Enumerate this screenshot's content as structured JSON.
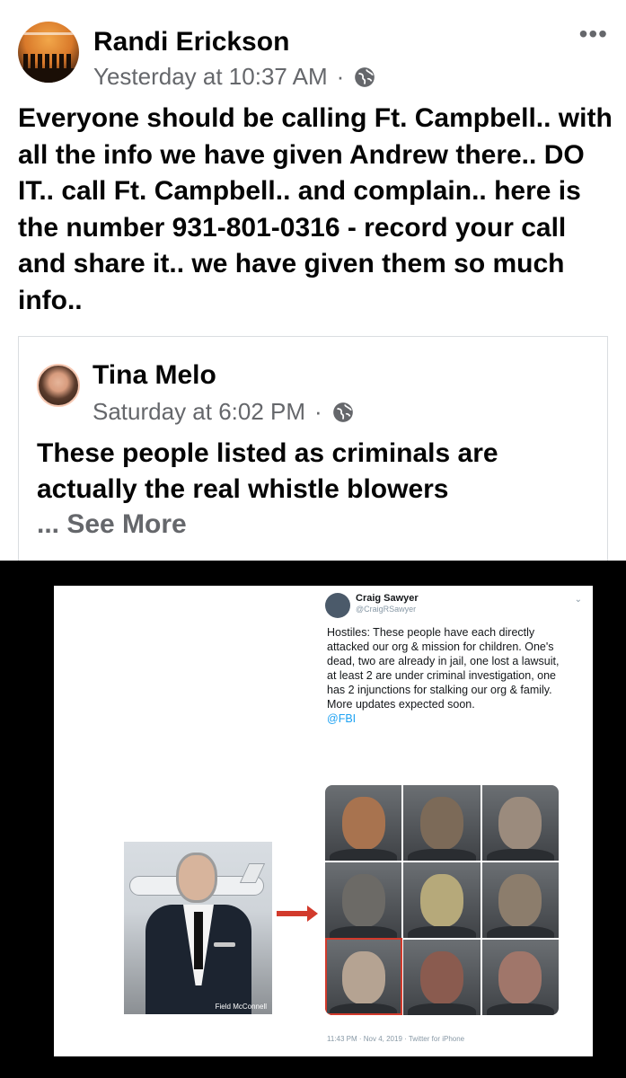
{
  "post": {
    "author": "Randi Erickson",
    "timestamp": "Yesterday at 10:37 AM",
    "separator": "·",
    "privacy_icon": "globe-icon",
    "more_icon": "ellipsis-icon",
    "more_label": "•••",
    "text": "Everyone should be calling Ft. Campbell.. with all the info we have given Andrew there..  DO IT.. call Ft. Campbell.. and complain.. here is the number 931-801-0316 - record your call and share it.. we have given them so much info.."
  },
  "shared_post": {
    "author": "Tina Melo",
    "timestamp": "Saturday at 6:02 PM",
    "separator": "·",
    "privacy_icon": "globe-icon",
    "text": "These people listed as criminals are actually the real whistle blowers",
    "see_more": "... See More"
  },
  "image": {
    "left_caption": "Field McConnell",
    "tweet": {
      "name": "Craig Sawyer",
      "handle": "@CraigRSawyer",
      "text": "Hostiles: These people have each directly attacked our org & mission for children. One's dead, two are already in jail, one lost a lawsuit, at least 2 are under criminal investigation, one has 2 injunctions for stalking our org & family. More updates expected soon.",
      "mention": "@FBI",
      "footer": "11:43 PM · Nov 4, 2019 · Twitter for iPhone"
    },
    "photo_grid_colors": [
      "#a8734f",
      "#7c6a58",
      "#9b8b7d",
      "#6c6a66",
      "#b6a97a",
      "#8c7d6c",
      "#b5a392",
      "#8a5b4f",
      "#a0766a"
    ]
  },
  "colors": {
    "text_primary": "#050505",
    "text_secondary": "#65676b",
    "highlight_red": "#d23a2c",
    "twitter_link": "#1da1f2"
  }
}
